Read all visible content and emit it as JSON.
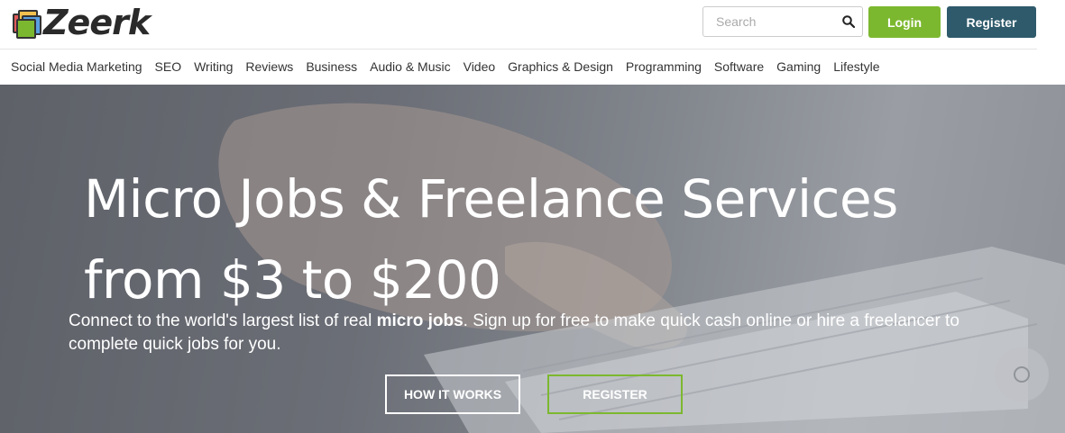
{
  "header": {
    "logo_text": "Zeerk",
    "search": {
      "placeholder": "Search"
    },
    "login_label": "Login",
    "register_label": "Register"
  },
  "nav": {
    "items": [
      "Social Media Marketing",
      "SEO",
      "Writing",
      "Reviews",
      "Business",
      "Audio & Music",
      "Video",
      "Graphics & Design",
      "Programming",
      "Software",
      "Gaming",
      "Lifestyle"
    ]
  },
  "hero": {
    "title_line1": "Micro Jobs & Freelance Services",
    "title_line2": "from $3 to $200",
    "subtitle_before": "Connect to the world's largest list of real ",
    "subtitle_bold": "micro jobs",
    "subtitle_after": ". Sign up for free to make quick cash online or hire a freelancer to complete quick jobs for you.",
    "how_it_works_label": "HOW IT WORKS",
    "register_label": "REGISTER"
  },
  "colors": {
    "login_green": "#7cb82f",
    "register_teal": "#2e5a6b"
  },
  "icons": {
    "search": "search-icon",
    "logo": "logo-icon",
    "hero_image": "keyboard-hands-image"
  }
}
